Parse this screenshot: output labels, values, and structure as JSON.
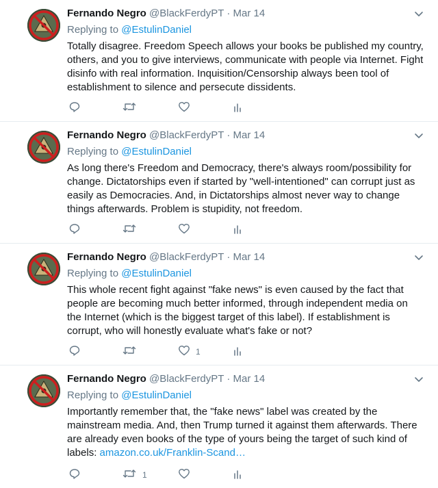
{
  "tweets": [
    {
      "name": "Fernando Negro",
      "handle": "@BlackFerdyPT",
      "separator": "·",
      "date": "Mar 14",
      "replying_prefix": "Replying to",
      "replying_to": "@EstulinDaniel",
      "text": "Totally disagree. Freedom Speech allows your books be published my country, others, and you to give interviews, communicate with people via Internet. Fight disinfo with real information. Inquisition/Censorship always been tool of establishment to silence and persecute dissidents.",
      "link": "",
      "retweets": "",
      "likes": ""
    },
    {
      "name": "Fernando Negro",
      "handle": "@BlackFerdyPT",
      "separator": "·",
      "date": "Mar 14",
      "replying_prefix": "Replying to",
      "replying_to": "@EstulinDaniel",
      "text": "As long there's Freedom and Democracy, there's always room/possibility for change. Dictatorships even if started by \"well-intentioned\" can corrupt just as easily as Democracies. And, in Dictatorships almost never way to change things afterwards. Problem is stupidity, not freedom.",
      "link": "",
      "retweets": "",
      "likes": ""
    },
    {
      "name": "Fernando Negro",
      "handle": "@BlackFerdyPT",
      "separator": "·",
      "date": "Mar 14",
      "replying_prefix": "Replying to",
      "replying_to": "@EstulinDaniel",
      "text": "This whole recent fight against \"fake news\" is even caused by the fact that people are becoming much better informed, through independent media on the Internet (which is the biggest target of this label). If establishment is corrupt, who will honestly evaluate what's fake or not?",
      "link": "",
      "retweets": "",
      "likes": "1"
    },
    {
      "name": "Fernando Negro",
      "handle": "@BlackFerdyPT",
      "separator": "·",
      "date": "Mar 14",
      "replying_prefix": "Replying to",
      "replying_to": "@EstulinDaniel",
      "text": "Importantly remember that, the \"fake news\" label was created by the mainstream media. And, then Trump turned it against them afterwards. There are already even books of the type of yours being the target of such kind of labels: ",
      "link": "amazon.co.uk/Franklin-Scand…",
      "retweets": "1",
      "likes": ""
    }
  ],
  "icons": {
    "reply": "reply-icon",
    "retweet": "retweet-icon",
    "like": "heart-icon",
    "analytics": "analytics-icon",
    "caret": "chevron-down-icon",
    "avatar": "anti-illuminati-avatar"
  },
  "colors": {
    "link": "#1b95e0",
    "secondary": "#657786",
    "text": "#14171a",
    "divider": "#e6ecf0"
  }
}
